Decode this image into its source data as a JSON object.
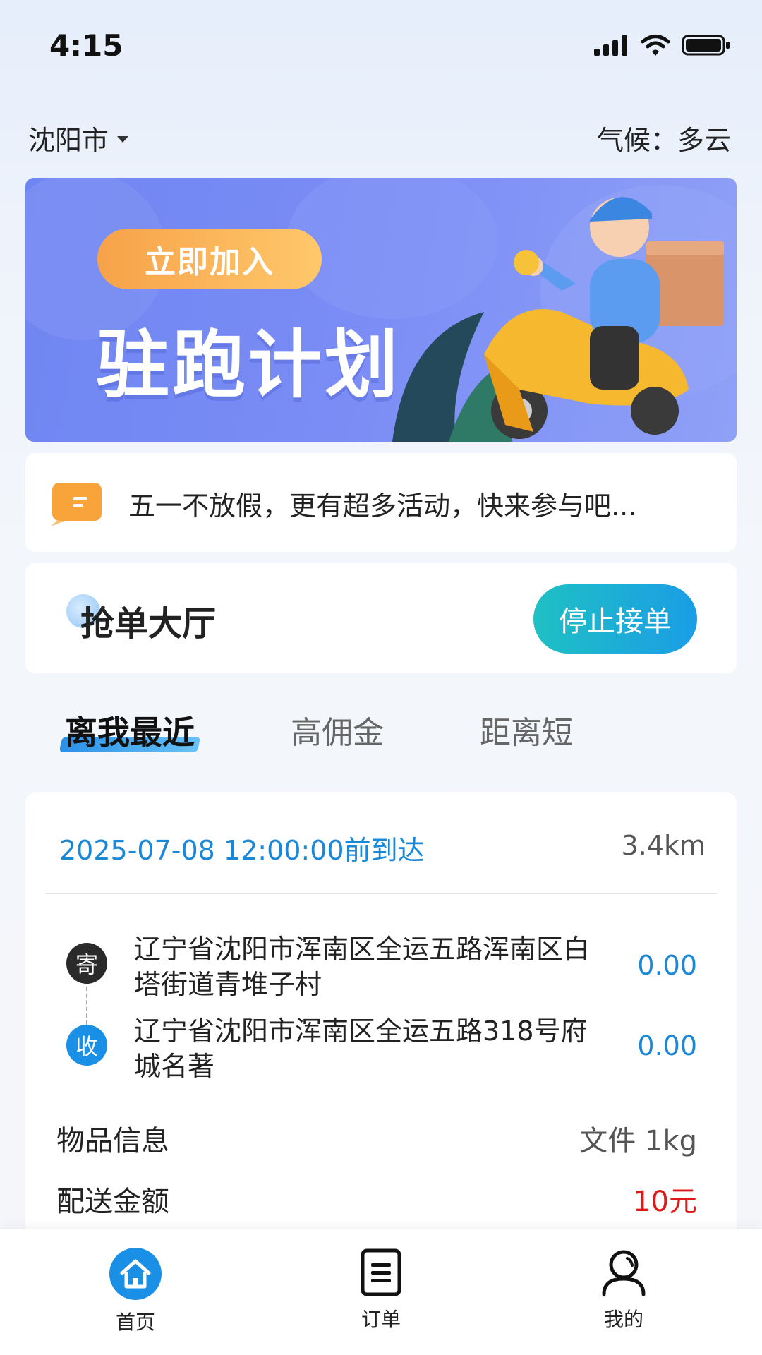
{
  "status_bar": {
    "time": "4:15"
  },
  "header": {
    "city": "沈阳市",
    "weather": "气候：多云"
  },
  "banner": {
    "join_label": "立即加入",
    "title": "驻跑计划"
  },
  "notice": {
    "text": "五一不放假，更有超多活动，快来参与吧..."
  },
  "hall": {
    "title": "抢单大厅",
    "stop_label": "停止接单"
  },
  "tabs": [
    {
      "label": "离我最近",
      "active": true
    },
    {
      "label": "高佣金",
      "active": false
    },
    {
      "label": "距离短",
      "active": false
    }
  ],
  "order": {
    "deadline": "2025-07-08  12:00:00前到达",
    "distance": "3.4km",
    "send_badge": "寄",
    "recv_badge": "收",
    "send_address": "辽宁省沈阳市浑南区全运五路浑南区白塔街道青堆子村",
    "send_amount": "0.00",
    "recv_address": "辽宁省沈阳市浑南区全运五路318号府城名著",
    "recv_amount": "0.00",
    "item_label": "物品信息",
    "item_value": "文件  1kg",
    "fee_label": "配送金额",
    "fee_value": "10元"
  },
  "nav": [
    {
      "label": "首页",
      "icon": "home-icon",
      "active": true
    },
    {
      "label": "订单",
      "icon": "order-list-icon",
      "active": false
    },
    {
      "label": "我的",
      "icon": "user-profile-icon",
      "active": false
    }
  ],
  "colors": {
    "accent": "#1a8fe6",
    "fee": "#e01818",
    "deadline": "#1a88d8"
  }
}
